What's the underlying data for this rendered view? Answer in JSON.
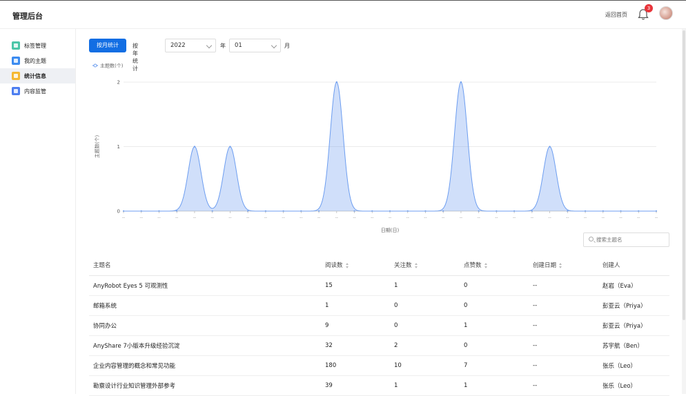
{
  "header": {
    "title": "管理后台",
    "home_link": "返回首页",
    "notification_count": "3"
  },
  "sidebar": {
    "items": [
      {
        "label": "标签管理",
        "icon": "tag-icon",
        "color": "#4cc6a8"
      },
      {
        "label": "我的主题",
        "icon": "topic-icon",
        "color": "#3b8bf0"
      },
      {
        "label": "统计信息",
        "icon": "stats-icon",
        "color": "#f5b833"
      },
      {
        "label": "内容监管",
        "icon": "shield-icon",
        "color": "#4d7ef0"
      }
    ],
    "active_index": 2
  },
  "toolbar": {
    "by_month_label": "按月统计",
    "by_year_label": "按年统计",
    "year_value": "2022",
    "year_unit": "年",
    "month_value": "01",
    "month_unit": "月"
  },
  "chart_data": {
    "type": "area",
    "legend": "主题数(个)",
    "ylabel": "主题数(个)",
    "xlabel": "日期(日)",
    "ylim": [
      0,
      2
    ],
    "yticks": [
      0,
      1,
      2
    ],
    "x_tick_label": "--",
    "x": [
      1,
      2,
      3,
      4,
      5,
      6,
      7,
      8,
      9,
      10,
      11,
      12,
      13,
      14,
      15,
      16,
      17,
      18,
      19,
      20,
      21,
      22,
      23,
      24,
      25,
      26,
      27,
      28,
      29,
      30,
      31
    ],
    "values": [
      0,
      0,
      0,
      0,
      1,
      0,
      1,
      0,
      0,
      0,
      0,
      0,
      2,
      0,
      0,
      0,
      0,
      0,
      0,
      2,
      0,
      0,
      0,
      0,
      1,
      0,
      0,
      0,
      0,
      0,
      0
    ],
    "color": "#6c9df0"
  },
  "search": {
    "placeholder": "搜索主题名"
  },
  "table": {
    "headers": [
      "主题名",
      "阅读数",
      "关注数",
      "点赞数",
      "创建日期",
      "创建人"
    ],
    "rows": [
      [
        "AnyRobot Eyes 5 可观测性",
        "15",
        "1",
        "0",
        "--",
        "赵岩（Eva）"
      ],
      [
        "邮箱系统",
        "1",
        "0",
        "0",
        "--",
        "彭亚云（Priya）"
      ],
      [
        "协同办公",
        "9",
        "0",
        "1",
        "--",
        "彭亚云（Priya）"
      ],
      [
        "AnyShare 7小版本升级经验沉淀",
        "32",
        "2",
        "0",
        "--",
        "苏宇航（Ben）"
      ],
      [
        "企业内容管理的概念和常见功能",
        "180",
        "10",
        "7",
        "--",
        "张乐（Leo）"
      ],
      [
        "勘察设计行业知识管理外部参考",
        "39",
        "1",
        "1",
        "--",
        "张乐（Leo）"
      ]
    ]
  }
}
